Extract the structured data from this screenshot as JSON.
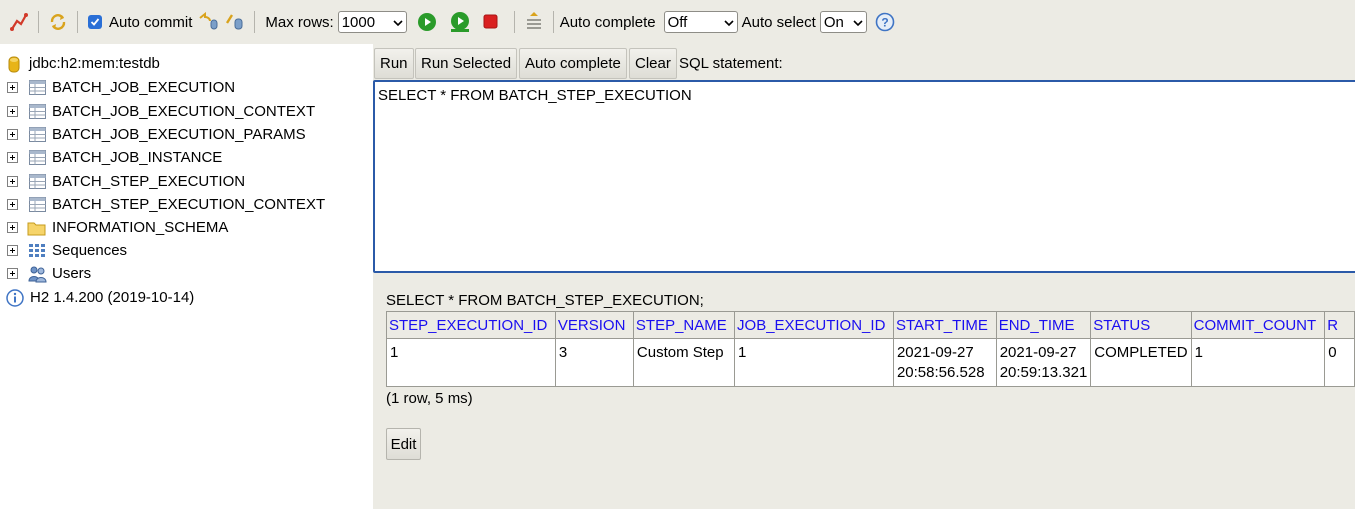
{
  "toolbar": {
    "auto_commit_label": "Auto commit",
    "auto_commit_checked": true,
    "max_rows_label": "Max rows:",
    "max_rows_value": "1000",
    "auto_complete_label": "Auto complete",
    "auto_complete_value": "Off",
    "auto_select_label": "Auto select",
    "auto_select_value": "On",
    "help_glyph": "?"
  },
  "tree": {
    "connection": "jdbc:h2:mem:testdb",
    "items": [
      {
        "label": "BATCH_JOB_EXECUTION",
        "icon": "table-icon"
      },
      {
        "label": "BATCH_JOB_EXECUTION_CONTEXT",
        "icon": "table-icon"
      },
      {
        "label": "BATCH_JOB_EXECUTION_PARAMS",
        "icon": "table-icon"
      },
      {
        "label": "BATCH_JOB_INSTANCE",
        "icon": "table-icon"
      },
      {
        "label": "BATCH_STEP_EXECUTION",
        "icon": "table-icon"
      },
      {
        "label": "BATCH_STEP_EXECUTION_CONTEXT",
        "icon": "table-icon"
      },
      {
        "label": "INFORMATION_SCHEMA",
        "icon": "folder-icon"
      },
      {
        "label": "Sequences",
        "icon": "sequences-icon"
      },
      {
        "label": "Users",
        "icon": "users-icon"
      }
    ],
    "version": "H2 1.4.200 (2019-10-14)"
  },
  "sql_buttons": {
    "run": "Run",
    "run_selected": "Run Selected",
    "auto_complete": "Auto complete",
    "clear": "Clear",
    "statement_label": "SQL statement:"
  },
  "sql_text": "SELECT * FROM BATCH_STEP_EXECUTION",
  "result": {
    "query": "SELECT * FROM BATCH_STEP_EXECUTION;",
    "columns": [
      "STEP_EXECUTION_ID",
      "VERSION",
      "STEP_NAME",
      "JOB_EXECUTION_ID",
      "START_TIME",
      "END_TIME",
      "STATUS",
      "COMMIT_COUNT",
      "R"
    ],
    "row": {
      "step_execution_id": "1",
      "version": "3",
      "step_name": "Custom Step",
      "job_execution_id": "1",
      "start_time_date": "2021-09-27",
      "start_time_time": "20:58:56.528",
      "end_time_date": "2021-09-27",
      "end_time_time": "20:59:13.321",
      "status": "COMPLETED",
      "commit_count": "1",
      "r": "0"
    },
    "row_info": "(1 row, 5 ms)",
    "edit_label": "Edit"
  },
  "colors": {
    "panel_bg": "#ecebe4",
    "header_text": "#1a0ef0",
    "sql_border": "#2b5aa8",
    "run_green": "#2a9b2a",
    "stop_red": "#d92020",
    "checkbox_blue": "#2a6fd6"
  }
}
